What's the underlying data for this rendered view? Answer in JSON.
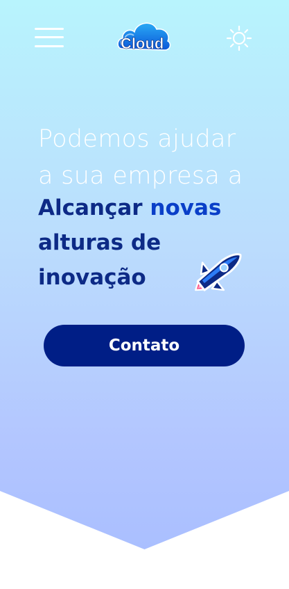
{
  "header": {
    "menu_icon": "hamburger-menu-icon",
    "logo_text": "Cloud",
    "theme_icon": "sun-icon"
  },
  "hero": {
    "headline_line1": "Podemos ajudar",
    "headline_line2": "a sua empresa a",
    "highlight_word1": "Alcançar",
    "highlight_word2": "novas",
    "highlight_line2": "alturas de",
    "highlight_line3": "inovação",
    "illustration": "rocket-icon",
    "cta_label": "Contato"
  },
  "colors": {
    "gradient_top": "#b8f4fd",
    "gradient_bottom": "#aabfff",
    "navy": "#001e86",
    "accent_blue": "#0a3fc8"
  }
}
